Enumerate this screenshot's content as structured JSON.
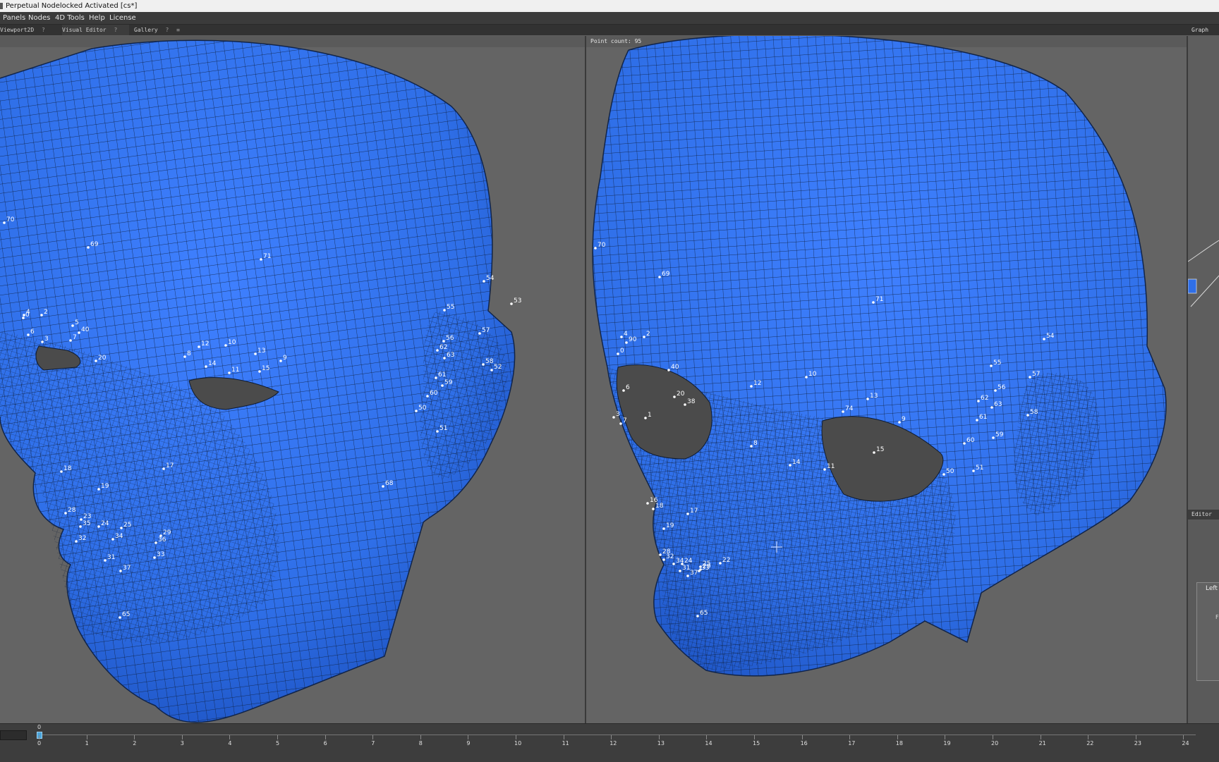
{
  "window": {
    "title": "Perpetual Nodelocked Activated  [cs*]"
  },
  "menu": [
    "Panels",
    "Nodes",
    "4D Tools",
    "Help",
    "License"
  ],
  "tabs": [
    {
      "label": "Viewport2D"
    },
    {
      "label": "Visual Editor"
    },
    {
      "label": "Gallery"
    }
  ],
  "graph_panel": {
    "title": "Graph"
  },
  "editor_panel": {
    "title": "Editor",
    "side_label": "Left",
    "field_label": "F"
  },
  "viewport_right": {
    "point_count": "Point count: 95"
  },
  "colors": {
    "mesh": "#2f6fe8",
    "background": "#646464",
    "eye_hole": "#4b4b4b",
    "wire": "#0d1b33"
  },
  "landmarks_left": [
    "70",
    "69",
    "71",
    "54",
    "53",
    "4",
    "2",
    "0",
    "5",
    "40",
    "6",
    "3",
    "7",
    "55",
    "56",
    "62",
    "63",
    "57",
    "58",
    "52",
    "12",
    "10",
    "13",
    "8",
    "9",
    "14",
    "11",
    "15",
    "20",
    "61",
    "59",
    "60",
    "50",
    "51",
    "18",
    "17",
    "19",
    "68",
    "28",
    "23",
    "35",
    "24",
    "25",
    "29",
    "32",
    "34",
    "36",
    "31",
    "33",
    "37",
    "65"
  ],
  "landmarks_right": [
    "70",
    "69",
    "71",
    "4",
    "2",
    "90",
    "0",
    "40",
    "6",
    "38",
    "3",
    "7",
    "1",
    "20",
    "12",
    "10",
    "13",
    "74",
    "9",
    "8",
    "15",
    "14",
    "11",
    "54",
    "55",
    "57",
    "56",
    "62",
    "63",
    "61",
    "58",
    "60",
    "59",
    "50",
    "51",
    "16",
    "18",
    "17",
    "19",
    "28",
    "32",
    "34",
    "24",
    "25",
    "29",
    "22",
    "31",
    "33",
    "37",
    "65"
  ],
  "timeline": {
    "current_frame": "0",
    "ticks": [
      "0",
      "1",
      "2",
      "3",
      "4",
      "5",
      "6",
      "7",
      "8",
      "9",
      "10",
      "11",
      "12",
      "13",
      "14",
      "15",
      "16",
      "17",
      "18",
      "19",
      "20",
      "21",
      "22",
      "23",
      "24"
    ]
  }
}
